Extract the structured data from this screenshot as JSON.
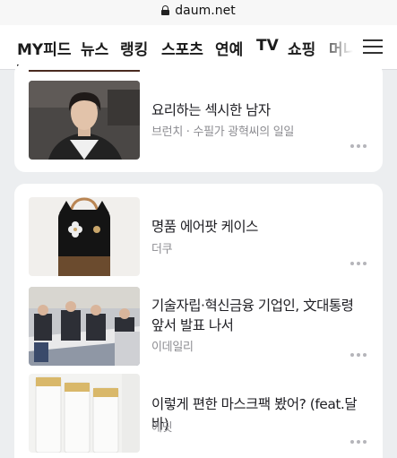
{
  "browser": {
    "url": "daum.net"
  },
  "gnb": {
    "tabs": [
      {
        "label": "MY피드",
        "active": true
      },
      {
        "label": "뉴스"
      },
      {
        "label": "랭킹"
      },
      {
        "label": "스포츠"
      },
      {
        "label": "연예"
      },
      {
        "label": "TV"
      },
      {
        "label": "쇼핑"
      },
      {
        "label": "머니"
      }
    ]
  },
  "cards": [
    {
      "items": [
        {
          "title": "요리하는 섹시한 남자",
          "source": "브런치 · 수필가 광혁씨의 일일",
          "image": "person-photo"
        }
      ]
    },
    {
      "items": [
        {
          "title": "명품 에어팟 케이스",
          "source": "더쿠",
          "image": "airpods-case-photo"
        },
        {
          "title": "기술자립·혁신금융 기업인, 文대통령 앞서 발표 나서",
          "source": "이데일리",
          "image": "conference-photo"
        },
        {
          "title": "이렇게 편한 마스크팩 봤어? (feat.달바)",
          "source": "에딧",
          "image": "mask-pack-photo"
        }
      ]
    }
  ]
}
